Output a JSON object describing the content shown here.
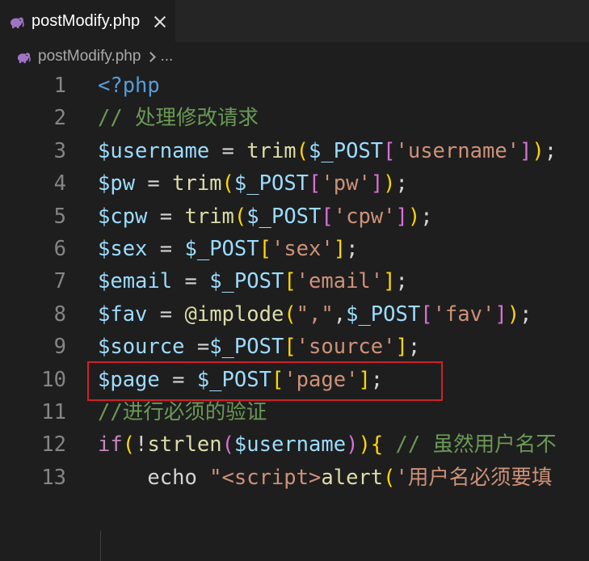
{
  "tab": {
    "filename": "postModify.php"
  },
  "breadcrumb": {
    "file": "postModify.php",
    "more": "..."
  },
  "colors": {
    "php_icon": "#a074c4",
    "highlight_border": "#d0202b"
  },
  "lines": [
    {
      "n": "1",
      "tokens": [
        {
          "t": "<?php",
          "c": "c-tag"
        }
      ]
    },
    {
      "n": "2",
      "tokens": [
        {
          "t": "// 处理修改请求",
          "c": "c-com"
        }
      ]
    },
    {
      "n": "3",
      "tokens": [
        {
          "t": "$username",
          "c": "c-var"
        },
        {
          "t": " = ",
          "c": "c-op"
        },
        {
          "t": "trim",
          "c": "c-fn"
        },
        {
          "t": "(",
          "c": "c-b1"
        },
        {
          "t": "$_POST",
          "c": "c-var"
        },
        {
          "t": "[",
          "c": "c-b2"
        },
        {
          "t": "'username'",
          "c": "c-str"
        },
        {
          "t": "]",
          "c": "c-b2"
        },
        {
          "t": ")",
          "c": "c-b1"
        },
        {
          "t": ";",
          "c": "c-op"
        }
      ]
    },
    {
      "n": "4",
      "tokens": [
        {
          "t": "$pw",
          "c": "c-var"
        },
        {
          "t": " = ",
          "c": "c-op"
        },
        {
          "t": "trim",
          "c": "c-fn"
        },
        {
          "t": "(",
          "c": "c-b1"
        },
        {
          "t": "$_POST",
          "c": "c-var"
        },
        {
          "t": "[",
          "c": "c-b2"
        },
        {
          "t": "'pw'",
          "c": "c-str"
        },
        {
          "t": "]",
          "c": "c-b2"
        },
        {
          "t": ")",
          "c": "c-b1"
        },
        {
          "t": ";",
          "c": "c-op"
        }
      ]
    },
    {
      "n": "5",
      "tokens": [
        {
          "t": "$cpw",
          "c": "c-var"
        },
        {
          "t": " = ",
          "c": "c-op"
        },
        {
          "t": "trim",
          "c": "c-fn"
        },
        {
          "t": "(",
          "c": "c-b1"
        },
        {
          "t": "$_POST",
          "c": "c-var"
        },
        {
          "t": "[",
          "c": "c-b2"
        },
        {
          "t": "'cpw'",
          "c": "c-str"
        },
        {
          "t": "]",
          "c": "c-b2"
        },
        {
          "t": ")",
          "c": "c-b1"
        },
        {
          "t": ";",
          "c": "c-op"
        }
      ]
    },
    {
      "n": "6",
      "tokens": [
        {
          "t": "$sex",
          "c": "c-var"
        },
        {
          "t": " = ",
          "c": "c-op"
        },
        {
          "t": "$_POST",
          "c": "c-var"
        },
        {
          "t": "[",
          "c": "c-b1"
        },
        {
          "t": "'sex'",
          "c": "c-str"
        },
        {
          "t": "]",
          "c": "c-b1"
        },
        {
          "t": ";",
          "c": "c-op"
        }
      ]
    },
    {
      "n": "7",
      "tokens": [
        {
          "t": "$email",
          "c": "c-var"
        },
        {
          "t": " = ",
          "c": "c-op"
        },
        {
          "t": "$_POST",
          "c": "c-var"
        },
        {
          "t": "[",
          "c": "c-b1"
        },
        {
          "t": "'email'",
          "c": "c-str"
        },
        {
          "t": "]",
          "c": "c-b1"
        },
        {
          "t": ";",
          "c": "c-op"
        }
      ]
    },
    {
      "n": "8",
      "tokens": [
        {
          "t": "$fav",
          "c": "c-var"
        },
        {
          "t": " = ",
          "c": "c-op"
        },
        {
          "t": "@implode",
          "c": "c-fn"
        },
        {
          "t": "(",
          "c": "c-b1"
        },
        {
          "t": "\",\"",
          "c": "c-str"
        },
        {
          "t": ",",
          "c": "c-op"
        },
        {
          "t": "$_POST",
          "c": "c-var"
        },
        {
          "t": "[",
          "c": "c-b2"
        },
        {
          "t": "'fav'",
          "c": "c-str"
        },
        {
          "t": "]",
          "c": "c-b2"
        },
        {
          "t": ")",
          "c": "c-b1"
        },
        {
          "t": ";",
          "c": "c-op"
        }
      ]
    },
    {
      "n": "9",
      "tokens": [
        {
          "t": "$source",
          "c": "c-var"
        },
        {
          "t": " =",
          "c": "c-op"
        },
        {
          "t": "$_POST",
          "c": "c-var"
        },
        {
          "t": "[",
          "c": "c-b1"
        },
        {
          "t": "'source'",
          "c": "c-str"
        },
        {
          "t": "]",
          "c": "c-b1"
        },
        {
          "t": ";",
          "c": "c-op"
        }
      ]
    },
    {
      "n": "10",
      "tokens": [
        {
          "t": "$page",
          "c": "c-var"
        },
        {
          "t": " = ",
          "c": "c-op"
        },
        {
          "t": "$_POST",
          "c": "c-var"
        },
        {
          "t": "[",
          "c": "c-b1"
        },
        {
          "t": "'page'",
          "c": "c-str"
        },
        {
          "t": "]",
          "c": "c-b1"
        },
        {
          "t": ";",
          "c": "c-op"
        }
      ]
    },
    {
      "n": "11",
      "tokens": [
        {
          "t": "//进行必须的验证",
          "c": "c-com"
        }
      ]
    },
    {
      "n": "12",
      "tokens": [
        {
          "t": "if",
          "c": "c-kw"
        },
        {
          "t": "(",
          "c": "c-b1"
        },
        {
          "t": "!",
          "c": "c-op"
        },
        {
          "t": "strlen",
          "c": "c-fn"
        },
        {
          "t": "(",
          "c": "c-b2"
        },
        {
          "t": "$username",
          "c": "c-var"
        },
        {
          "t": ")",
          "c": "c-b2"
        },
        {
          "t": ")",
          "c": "c-b1"
        },
        {
          "t": "{",
          "c": "c-b1"
        },
        {
          "t": " // 虽然用户名不",
          "c": "c-com"
        }
      ]
    },
    {
      "n": "13",
      "tokens": [
        {
          "t": "    echo ",
          "c": "c-echo"
        },
        {
          "t": "\"",
          "c": "c-str"
        },
        {
          "t": "<script>",
          "c": "c-str"
        },
        {
          "t": "alert",
          "c": "c-fn"
        },
        {
          "t": "(",
          "c": "c-b1"
        },
        {
          "t": "'用户名必须要填",
          "c": "c-str"
        }
      ]
    }
  ]
}
